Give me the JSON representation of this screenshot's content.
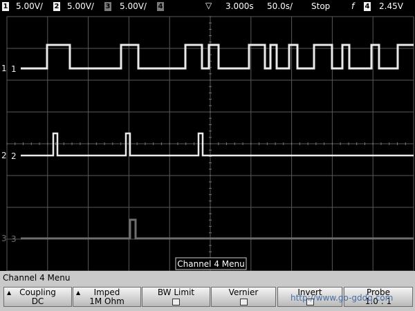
{
  "header": {
    "ch1_num": "1",
    "ch1_scale": "5.00V/",
    "ch2_num": "2",
    "ch2_scale": "5.00V/",
    "ch3_num": "3",
    "ch3_scale": "5.00V/",
    "ch4_num": "4",
    "trigger_marker": "▽",
    "time_pos": "3.000s",
    "time_scale": "50.0s/",
    "run_state": "Stop",
    "trigger_edge": "f",
    "trig_src": "4",
    "trig_level": "2.45V"
  },
  "channels": {
    "ch1_label": "1",
    "ch2_label": "2",
    "ch3_label": "3"
  },
  "popup": {
    "label": "Channel 4  Menu"
  },
  "menu": {
    "title": "Channel 4  Menu",
    "coupling_label": "Coupling",
    "coupling_value": "DC",
    "imped_label": "Imped",
    "imped_value": "1M Ohm",
    "bw_label": "BW Limit",
    "vernier_label": "Vernier",
    "invert_label": "Invert",
    "probe_label": "Probe",
    "probe_value": "1.0 : 1"
  },
  "watermark": "http://www.go-gddq.com",
  "colors": {
    "trace": "#eaeaea",
    "trace3": "#6e6e6e",
    "grid": "#5a5a5a",
    "menu": "#c9c9c9"
  }
}
